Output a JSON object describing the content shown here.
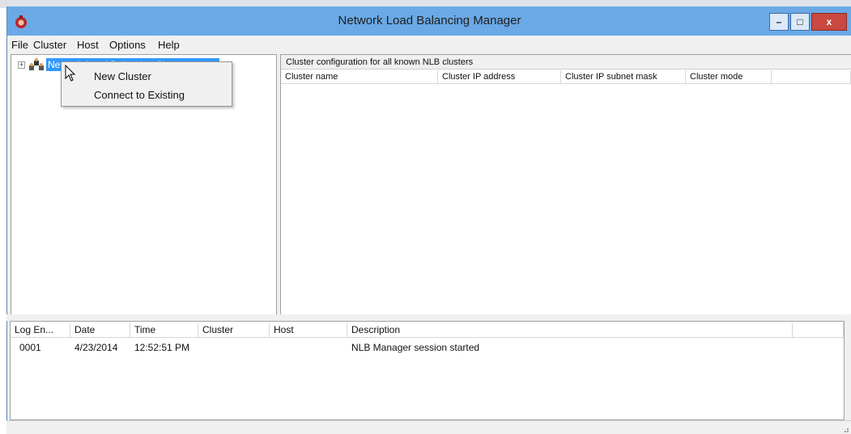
{
  "window": {
    "title": "Network Load Balancing Manager",
    "minimize_label": "–",
    "maximize_label": "□",
    "close_label": "x",
    "accent": "#6aa9e6"
  },
  "menubar": {
    "items": [
      "File",
      "Cluster",
      "Host",
      "Options",
      "Help"
    ]
  },
  "tree": {
    "root_label": "Network Load Balancing Clusters",
    "expander": "+",
    "selection_color": "#3399ff"
  },
  "context_menu": {
    "items": [
      "New Cluster",
      "Connect to Existing"
    ]
  },
  "cluster_pane": {
    "caption": "Cluster configuration for all known NLB clusters",
    "columns": [
      "Cluster name",
      "Cluster IP address",
      "Cluster IP subnet mask",
      "Cluster mode"
    ]
  },
  "log": {
    "columns": [
      "Log En...",
      "Date",
      "Time",
      "Cluster",
      "Host",
      "Description"
    ],
    "rows": [
      {
        "entry": "0001",
        "date": "4/23/2014",
        "time": "12:52:51 PM",
        "cluster": "",
        "host": "",
        "description": "NLB Manager session started"
      }
    ]
  },
  "icons": {
    "app": "nlb-app-icon",
    "tree_node": "cluster-nodes-icon",
    "cursor": "mouse-pointer-icon",
    "resize": "resize-grip-icon"
  }
}
